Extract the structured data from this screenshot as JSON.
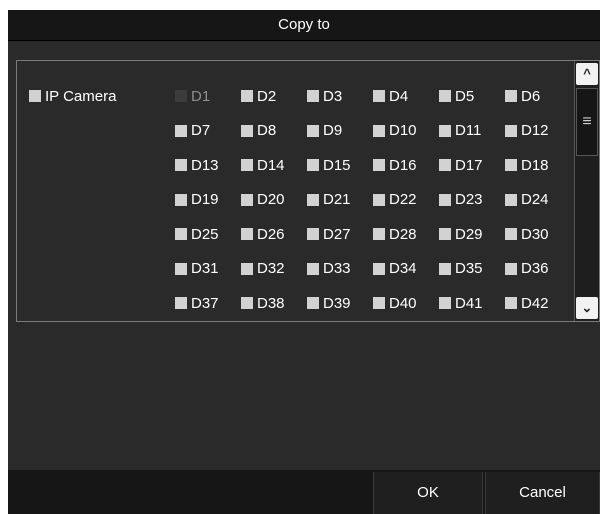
{
  "dialog": {
    "title": "Copy to",
    "camera_group_label": "IP Camera",
    "channels": [
      {
        "label": "D1",
        "disabled": true
      },
      {
        "label": "D2"
      },
      {
        "label": "D3"
      },
      {
        "label": "D4"
      },
      {
        "label": "D5"
      },
      {
        "label": "D6"
      },
      {
        "label": "D7"
      },
      {
        "label": "D8"
      },
      {
        "label": "D9"
      },
      {
        "label": "D10"
      },
      {
        "label": "D11"
      },
      {
        "label": "D12"
      },
      {
        "label": "D13"
      },
      {
        "label": "D14"
      },
      {
        "label": "D15"
      },
      {
        "label": "D16"
      },
      {
        "label": "D17"
      },
      {
        "label": "D18"
      },
      {
        "label": "D19"
      },
      {
        "label": "D20"
      },
      {
        "label": "D21"
      },
      {
        "label": "D22"
      },
      {
        "label": "D23"
      },
      {
        "label": "D24"
      },
      {
        "label": "D25"
      },
      {
        "label": "D26"
      },
      {
        "label": "D27"
      },
      {
        "label": "D28"
      },
      {
        "label": "D29"
      },
      {
        "label": "D30"
      },
      {
        "label": "D31"
      },
      {
        "label": "D32"
      },
      {
        "label": "D33"
      },
      {
        "label": "D34"
      },
      {
        "label": "D35"
      },
      {
        "label": "D36"
      },
      {
        "label": "D37"
      },
      {
        "label": "D38"
      },
      {
        "label": "D39"
      },
      {
        "label": "D40"
      },
      {
        "label": "D41"
      },
      {
        "label": "D42"
      }
    ],
    "ok_label": "OK",
    "cancel_label": "Cancel",
    "icons": {
      "scroll_up": "chevron-up-icon",
      "scroll_down": "chevron-down-icon",
      "thumb": "menu-lines-icon"
    },
    "colors": {
      "background": "#2a2a2a",
      "titlebar": "#161616",
      "checkbox": "#d2d2d2",
      "text": "#ffffff"
    }
  }
}
